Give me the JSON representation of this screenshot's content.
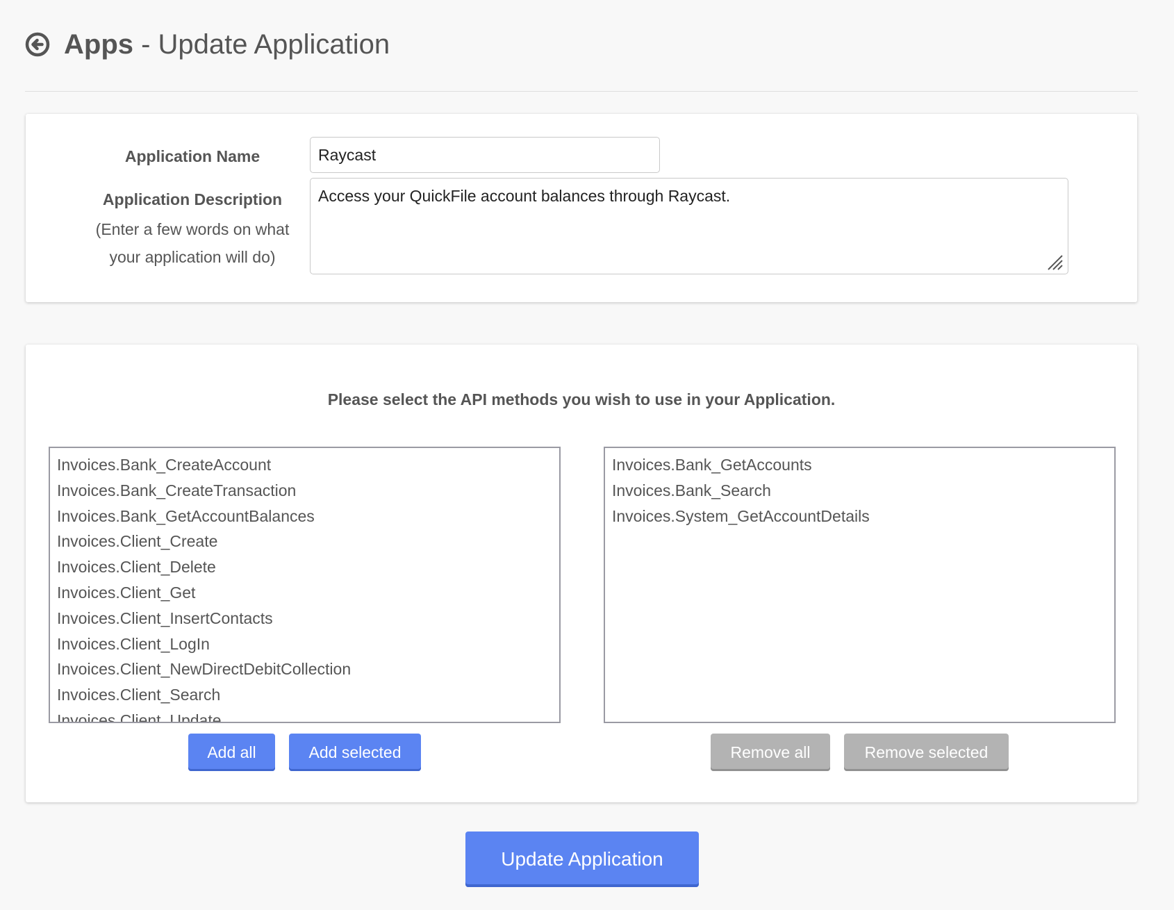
{
  "header": {
    "title_strong": "Apps",
    "title_rest": " - Update Application",
    "back_icon": "circle-arrow-left-icon"
  },
  "details": {
    "name_label": "Application Name",
    "name_value": "Raycast",
    "description_label": "Application Description",
    "description_hint_line1": "(Enter a few words on what",
    "description_hint_line2": "your application will do)",
    "description_value": "Access your QuickFile account balances through Raycast."
  },
  "methods": {
    "heading": "Please select the API methods you wish to use in your Application.",
    "available": [
      "Invoices.Bank_CreateAccount",
      "Invoices.Bank_CreateTransaction",
      "Invoices.Bank_GetAccountBalances",
      "Invoices.Client_Create",
      "Invoices.Client_Delete",
      "Invoices.Client_Get",
      "Invoices.Client_InsertContacts",
      "Invoices.Client_LogIn",
      "Invoices.Client_NewDirectDebitCollection",
      "Invoices.Client_Search",
      "Invoices.Client_Update"
    ],
    "selected": [
      "Invoices.Bank_GetAccounts",
      "Invoices.Bank_Search",
      "Invoices.System_GetAccountDetails"
    ],
    "add_all_label": "Add all",
    "add_selected_label": "Add selected",
    "remove_all_label": "Remove all",
    "remove_selected_label": "Remove selected"
  },
  "update_button_label": "Update Application",
  "colors": {
    "primary": "#5b84f2",
    "disabled": "#b3b3b3",
    "text": "#555555",
    "background": "#f8f8f8"
  }
}
